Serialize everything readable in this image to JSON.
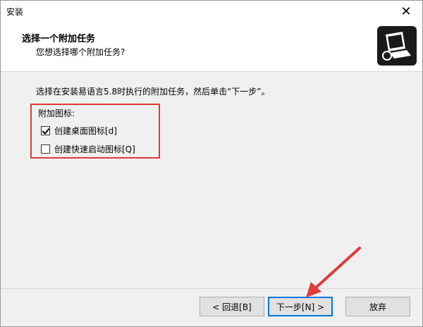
{
  "window": {
    "title": "安装",
    "close_glyph": "✕"
  },
  "header": {
    "title": "选择一个附加任务",
    "subtitle": "您想选择哪个附加任务?",
    "icon": "installer-computer-icon"
  },
  "content": {
    "instruction": "选择在安装易语言5.8时执行的附加任务，然后单击“下一步”。",
    "group_label": "附加图标:",
    "options": [
      {
        "label": "创建桌面图标[d]",
        "checked": true
      },
      {
        "label": "创建快速启动图标[Q]",
        "checked": false
      }
    ]
  },
  "buttons": {
    "back": "< 回退[B]",
    "next": "下一步[N] >",
    "cancel": "放弃"
  },
  "colors": {
    "highlight": "#e03a3a",
    "accent": "#0078d7"
  }
}
